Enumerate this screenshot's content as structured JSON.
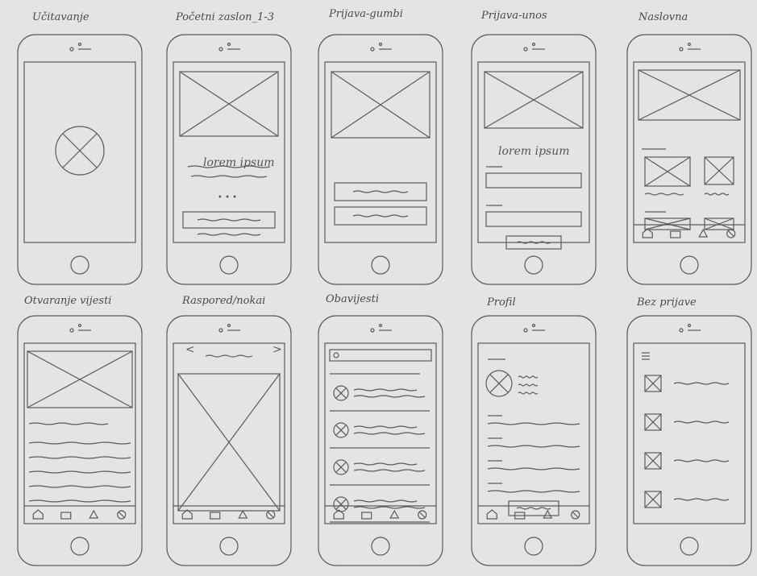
{
  "sheet": {
    "paper_color": "#e6e4e2",
    "ink_color": "#5a5a5a",
    "screens": [
      {
        "title": "Učitavanje"
      },
      {
        "title": "Početni zaslon_1-3",
        "body_text": "lorem ipsum",
        "dots": "• • •"
      },
      {
        "title": "Prijava-gumbi"
      },
      {
        "title": "Prijava-unos",
        "body_text": "lorem ipsum"
      },
      {
        "title": "Naslovna"
      },
      {
        "title": "Otvaranje vijesti"
      },
      {
        "title": "Raspored/nokai",
        "prev": "<",
        "next": ">"
      },
      {
        "title": "Obavijesti"
      },
      {
        "title": "Profil"
      },
      {
        "title": "Bez prijave"
      }
    ]
  }
}
